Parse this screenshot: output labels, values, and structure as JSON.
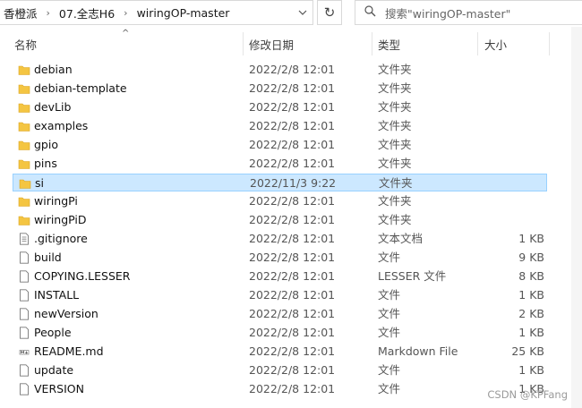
{
  "breadcrumb": [
    "香橙派",
    "07.全志H6",
    "wiringOP-master"
  ],
  "search": {
    "placeholder": "搜索\"wiringOP-master\""
  },
  "columns": {
    "name": "名称",
    "date": "修改日期",
    "type": "类型",
    "size": "大小"
  },
  "rows": [
    {
      "name": "debian",
      "date": "2022/2/8 12:01",
      "type": "文件夹",
      "size": "",
      "icon": "folder-icon"
    },
    {
      "name": "debian-template",
      "date": "2022/2/8 12:01",
      "type": "文件夹",
      "size": "",
      "icon": "folder-icon"
    },
    {
      "name": "devLib",
      "date": "2022/2/8 12:01",
      "type": "文件夹",
      "size": "",
      "icon": "folder-icon"
    },
    {
      "name": "examples",
      "date": "2022/2/8 12:01",
      "type": "文件夹",
      "size": "",
      "icon": "folder-icon"
    },
    {
      "name": "gpio",
      "date": "2022/2/8 12:01",
      "type": "文件夹",
      "size": "",
      "icon": "folder-icon"
    },
    {
      "name": "pins",
      "date": "2022/2/8 12:01",
      "type": "文件夹",
      "size": "",
      "icon": "folder-icon"
    },
    {
      "name": "si",
      "date": "2022/11/3 9:22",
      "type": "文件夹",
      "size": "",
      "icon": "folder-icon",
      "selected": true
    },
    {
      "name": "wiringPi",
      "date": "2022/2/8 12:01",
      "type": "文件夹",
      "size": "",
      "icon": "folder-icon"
    },
    {
      "name": "wiringPiD",
      "date": "2022/2/8 12:01",
      "type": "文件夹",
      "size": "",
      "icon": "folder-icon"
    },
    {
      "name": ".gitignore",
      "date": "2022/2/8 12:01",
      "type": "文本文档",
      "size": "1 KB",
      "icon": "text-document-icon"
    },
    {
      "name": "build",
      "date": "2022/2/8 12:01",
      "type": "文件",
      "size": "9 KB",
      "icon": "file-icon"
    },
    {
      "name": "COPYING.LESSER",
      "date": "2022/2/8 12:01",
      "type": "LESSER 文件",
      "size": "8 KB",
      "icon": "file-icon"
    },
    {
      "name": "INSTALL",
      "date": "2022/2/8 12:01",
      "type": "文件",
      "size": "1 KB",
      "icon": "file-icon"
    },
    {
      "name": "newVersion",
      "date": "2022/2/8 12:01",
      "type": "文件",
      "size": "2 KB",
      "icon": "file-icon"
    },
    {
      "name": "People",
      "date": "2022/2/8 12:01",
      "type": "文件",
      "size": "1 KB",
      "icon": "file-icon"
    },
    {
      "name": "README.md",
      "date": "2022/2/8 12:01",
      "type": "Markdown File",
      "size": "25 KB",
      "icon": "markdown-file-icon"
    },
    {
      "name": "update",
      "date": "2022/2/8 12:01",
      "type": "文件",
      "size": "1 KB",
      "icon": "file-icon"
    },
    {
      "name": "VERSION",
      "date": "2022/2/8 12:01",
      "type": "文件",
      "size": "1 KB",
      "icon": "file-icon"
    }
  ],
  "watermark": "CSDN @KPFang",
  "colors": {
    "folder": "#f4c542",
    "selection": "#cce8ff",
    "selection_border": "#99d1ff"
  }
}
